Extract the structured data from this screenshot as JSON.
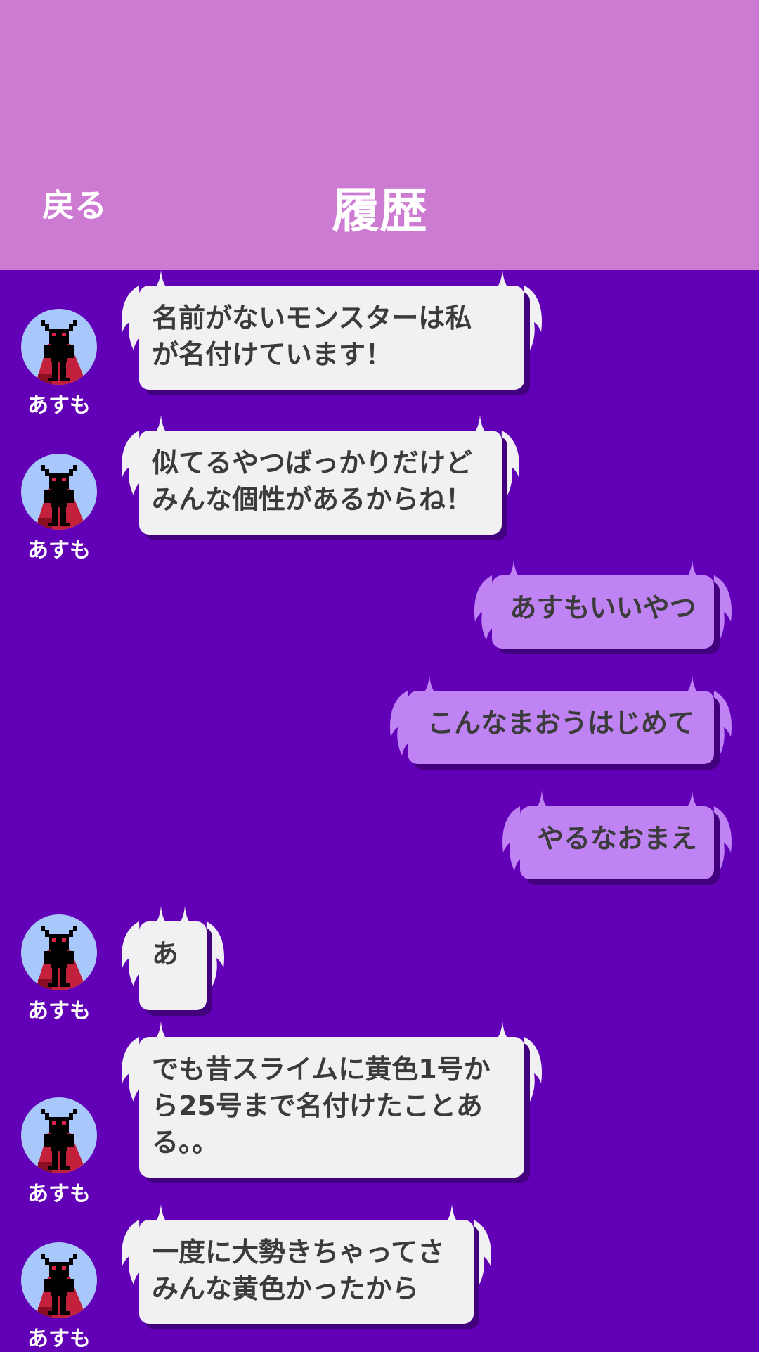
{
  "header": {
    "back_label": "戻る",
    "title": "履歴"
  },
  "colors": {
    "header_bg": "#cd7ad3",
    "chat_bg": "#6200b8",
    "npc_bubble": "#f1f1f3",
    "user_bubble": "#bf83f3",
    "avatar_bg": "#a8c8fb"
  },
  "messages": [
    {
      "sender": "npc",
      "name": "あすも",
      "text": "名前がないモンスターは私\nが名付けています！"
    },
    {
      "sender": "npc",
      "name": "あすも",
      "text": "似てるやつばっかりだけど\nみんな個性があるからね！"
    },
    {
      "sender": "user",
      "text": "あすもいいやつ"
    },
    {
      "sender": "user",
      "text": "こんなまおうはじめて"
    },
    {
      "sender": "user",
      "text": "やるなおまえ"
    },
    {
      "sender": "npc",
      "name": "あすも",
      "text": "あ"
    },
    {
      "sender": "npc",
      "name": "あすも",
      "text": "でも昔スライムに黄色1号か\nら25号まで名付けたことあ\nる。。"
    },
    {
      "sender": "npc",
      "name": "あすも",
      "text": "一度に大勢きちゃってさ\nみんな黄色かったから"
    }
  ]
}
